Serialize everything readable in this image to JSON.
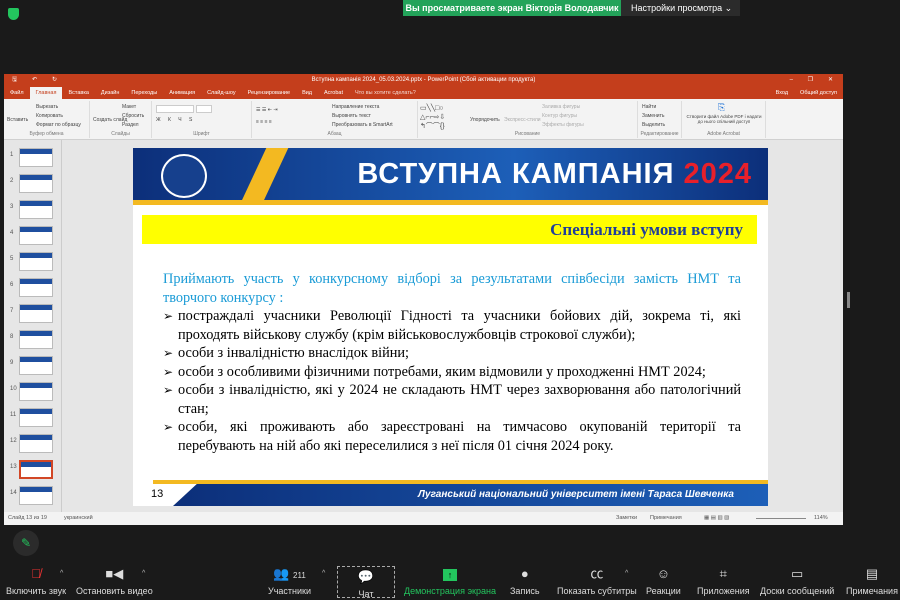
{
  "zoom": {
    "banner": "Вы просматриваете экран Вікторія Володавчик",
    "view_settings": "Настройки просмотра",
    "toolbar": {
      "mute": "Включить звук",
      "video": "Остановить видео",
      "participants": "Участники",
      "participants_count": "211",
      "chat": "Чат",
      "share": "Демонстрация экрана",
      "record": "Запись",
      "captions": "Показать субтитры",
      "reactions": "Реакции",
      "apps": "Приложения",
      "whiteboards": "Доски сообщений",
      "notes": "Примечания"
    },
    "colors": {
      "share_green": "#23c55e",
      "ppt_red": "#c43e1c"
    }
  },
  "ppt": {
    "title": "Вступна кампанія 2024_05.03.2024.pptx - PowerPoint (Сбой активации продукта)",
    "signin": "Вход",
    "share": "Общий доступ",
    "tabs": [
      "Файл",
      "Главная",
      "Вставка",
      "Дизайн",
      "Переходы",
      "Анимация",
      "Слайд-шоу",
      "Рецензирование",
      "Вид",
      "Acrobat"
    ],
    "tell_me": "Что вы хотите сделать?",
    "ribbon": {
      "paste": "Вставить",
      "cut": "Вырезать",
      "copy": "Копировать",
      "format_painter": "Формат по образцу",
      "clipboard": "Буфер обмена",
      "new_slide": "Создать слайд",
      "layout": "Макет",
      "reset": "Сбросить",
      "section": "Раздел",
      "slides": "Слайды",
      "font": "Шрифт",
      "text_dir": "Направление текста",
      "align_text": "Выровнять текст",
      "smartart": "Преобразовать в SmartArt",
      "paragraph": "Абзац",
      "arrange": "Упорядочить",
      "quick_styles": "Экспресс-стили",
      "fill": "Заливка фигуры",
      "outline": "Контур фигуры",
      "effects": "Эффекты фигуры",
      "drawing": "Рисование",
      "find": "Найти",
      "replace": "Заменить",
      "select": "Выделить",
      "editing": "Редактирование",
      "acrobat_btn": "Створити файл Adobe PDF і надати до нього спільний доступ",
      "acrobat": "Adobe Acrobat"
    },
    "thumbnails": [
      "1",
      "2",
      "3",
      "4",
      "5",
      "6",
      "7",
      "8",
      "9",
      "10",
      "11",
      "12",
      "13",
      "14"
    ],
    "selected_slide": 13,
    "status": {
      "slide": "Слайд 13 из 19",
      "lang": "украинский",
      "notes": "Заметки",
      "comments": "Примечания",
      "zoom": "114%"
    }
  },
  "slide": {
    "title": "ВСТУПНА КАМПАНІЯ",
    "year": "2024",
    "subtitle": "Спеціальні умови вступу",
    "lead": "Приймають участь у конкурсному відборі за результатами співбесіди замість НМТ та творчого конкурсу :",
    "items": [
      "постраждалі учасники Революції Гідності та учасники бойових дій, зокрема ті, які проходять військову службу (крім військовослужбовців строкової служби);",
      "особи з інвалідністю внаслідок війни;",
      "особи з особливими фізичними потребами, яким відмовили у проходженні НМТ 2024;",
      "особи з інвалідністю, які у 2024 не складають НМТ через захворювання або патологічний стан;",
      "особи, які проживають або зареєстровані на тимчасово окупованій території та перебувають на ній або які переселилися з неї після 01 січня 2024 року."
    ],
    "number": "13",
    "footer": "Луганський національний університет імені Тараса Шевченка"
  }
}
